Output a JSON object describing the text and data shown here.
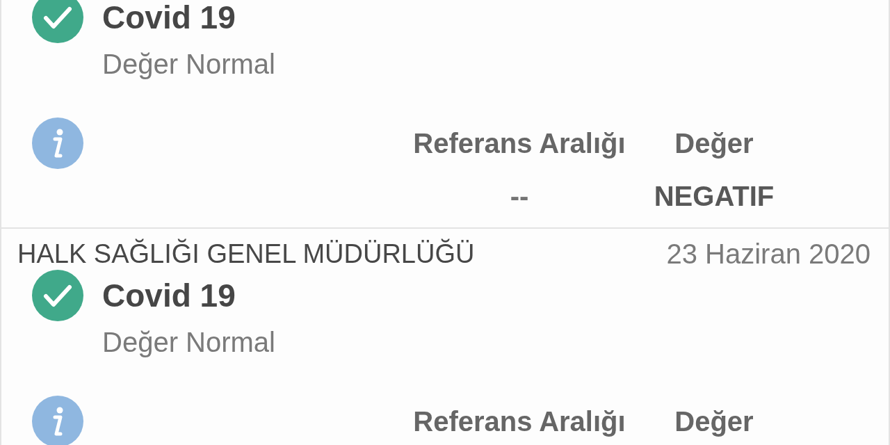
{
  "results": [
    {
      "test": "Covid 19",
      "normal": true,
      "status": "Değer Normal",
      "columns": [
        "Referans Aralığı",
        "Değer"
      ],
      "values": [
        "--",
        "NEGATIF"
      ]
    },
    {
      "institution": "HALK SAĞLIĞI GENEL MÜDÜRLÜĞÜ",
      "date": "23 Haziran 2020",
      "test": "Covid 19",
      "normal": true,
      "status": "Değer Normal",
      "columns": [
        "Referans Aralığı",
        "Değer"
      ]
    }
  ]
}
